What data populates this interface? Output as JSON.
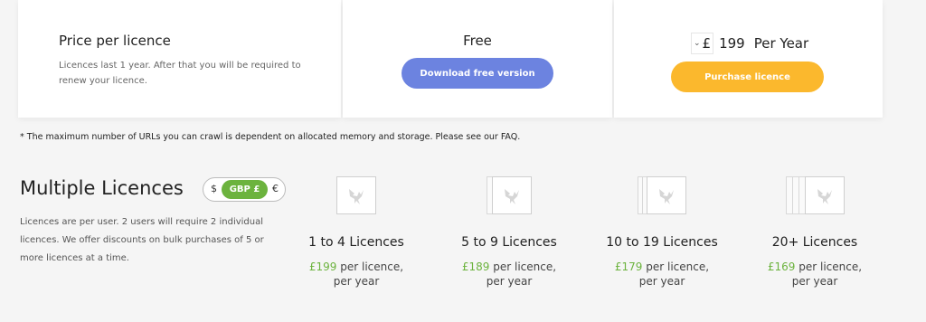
{
  "licence_card": {
    "title": "Price per licence",
    "description": "Licences last 1 year. After that you will be required to renew your licence."
  },
  "free_card": {
    "title": "Free",
    "button_label": "Download free version"
  },
  "paid_card": {
    "currency_symbol": "£",
    "amount": "199",
    "period": "Per Year",
    "button_label": "Purchase licence"
  },
  "footnote": "* The maximum number of URLs you can crawl is dependent on allocated memory and storage. Please see our FAQ.",
  "multiple": {
    "heading": "Multiple Licences",
    "currency_toggle": {
      "usd": "$",
      "gbp": "GBP £",
      "eur": "€",
      "selected": "GBP £"
    },
    "description": "Licences are per user. 2 users will require 2 individual licences. We offer discounts on bulk purchases of 5 or more licences at a time.",
    "tiers": [
      {
        "label": "1 to 4 Licences",
        "price": "£199",
        "price_suffix": " per licence,",
        "period": "per year",
        "stack": 1
      },
      {
        "label": "5 to 9 Licences",
        "price": "£189",
        "price_suffix": " per licence,",
        "period": "per year",
        "stack": 2
      },
      {
        "label": "10 to 19 Licences",
        "price": "£179",
        "price_suffix": " per licence,",
        "period": "per year",
        "stack": 3
      },
      {
        "label": "20+ Licences",
        "price": "£169",
        "price_suffix": " per licence,",
        "period": "per year",
        "stack": 4
      }
    ]
  },
  "colors": {
    "download_button": "#6c83e0",
    "purchase_button": "#fbb82d",
    "price_green": "#6cb33e"
  }
}
